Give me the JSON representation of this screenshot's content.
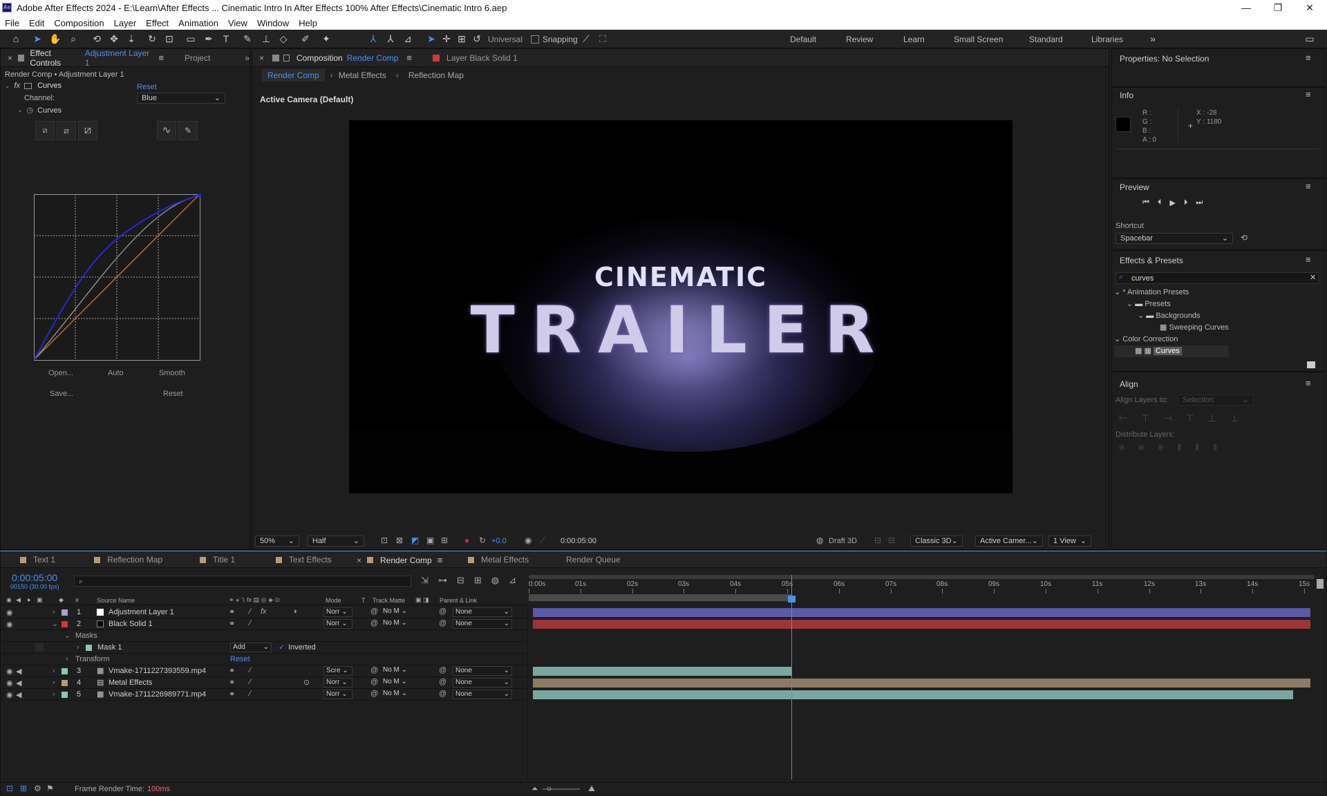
{
  "app": {
    "title": "Adobe After Effects 2024 - E:\\Learn\\After Effects ... Cinematic Intro In After Effects 100% After Effects\\Cinematic Intro 6.aep",
    "logo": "Ae"
  },
  "menu": [
    "File",
    "Edit",
    "Composition",
    "Layer",
    "Effect",
    "Animation",
    "View",
    "Window",
    "Help"
  ],
  "toolbar": {
    "universal": "Universal",
    "snapping": "Snapping",
    "workspaces": [
      "Default",
      "Review",
      "Learn",
      "Small Screen",
      "Standard",
      "Libraries"
    ]
  },
  "effect_controls": {
    "tab_label": "Effect Controls",
    "tab_layer": "Adjustment Layer 1",
    "project_tab": "Project",
    "breadcrumb": "Render Comp • Adjustment Layer 1",
    "effect_name": "Curves",
    "reset": "Reset",
    "channel_label": "Channel:",
    "channel_value": "Blue",
    "curves_label": "Curves",
    "buttons": [
      "Open...",
      "Auto",
      "Smooth",
      "Save...",
      "Reset"
    ]
  },
  "comp_panel": {
    "tab_label": "Composition",
    "tab_comp": "Render Comp",
    "layer_tab": "Layer  Black Solid 1",
    "nav": [
      "Render Comp",
      "Metal Effects",
      "Reflection Map"
    ],
    "camera": "Active Camera (Default)",
    "viewer_title_top": "CINEMATIC",
    "viewer_title_main": "TRAILER",
    "zoom": "50%",
    "resolution": "Half",
    "exposure": "+0.0",
    "timecode": "0:00:05:00",
    "renderer_label": "Draft 3D",
    "renderer": "Classic 3D",
    "camera_select": "Active Camer...",
    "views": "1 View"
  },
  "properties": {
    "title": "Properties: No Selection"
  },
  "info": {
    "title": "Info",
    "r": "R :",
    "g": "G :",
    "b": "B :",
    "a": "A : 0",
    "x": "X : -28",
    "y": "Y : 1180"
  },
  "preview": {
    "title": "Preview",
    "shortcut_label": "Shortcut",
    "shortcut": "Spacebar"
  },
  "effects_presets": {
    "title": "Effects & Presets",
    "search": "curves",
    "tree": [
      {
        "label": "* Animation Presets",
        "indent": 0
      },
      {
        "label": "Presets",
        "indent": 1
      },
      {
        "label": "Backgrounds",
        "indent": 2
      },
      {
        "label": "Sweeping Curves",
        "indent": 3
      },
      {
        "label": "Color Correction",
        "indent": 0
      },
      {
        "label": "Curves",
        "indent": 1
      }
    ]
  },
  "align": {
    "title": "Align",
    "align_to_label": "Align Layers to:",
    "align_to": "Selection",
    "distribute": "Distribute Layers:"
  },
  "timeline": {
    "tabs": [
      "Text 1",
      "Reflection Map",
      "Title 1",
      "Text Effects",
      "Render Comp",
      "Metal Effects",
      "Render Queue"
    ],
    "timecode": "0:00:05:00",
    "frames": "00150 (30.00 fps)",
    "columns": {
      "num": "#",
      "source": "Source Name",
      "mode": "Mode",
      "t": "T",
      "track": "Track Matte",
      "parent": "Parent & Link"
    },
    "ruler": [
      "0:00s",
      "01s",
      "02s",
      "03s",
      "04s",
      "05s",
      "06s",
      "07s",
      "08s",
      "09s",
      "10s",
      "11s",
      "12s",
      "13s",
      "14s",
      "15s"
    ],
    "layers": [
      {
        "num": "1",
        "name": "Adjustment Layer 1",
        "color": "#a9a2cc",
        "mode": "Norr",
        "track": "No M",
        "parent": "None"
      },
      {
        "num": "2",
        "name": "Black Solid 1",
        "color": "#cc3a3a",
        "mode": "Norr",
        "track": "No M",
        "parent": "None"
      },
      {
        "num": "3",
        "name": "Vmake-1711227393559.mp4",
        "color": "#8fc6b8",
        "mode": "Scre",
        "track": "No M",
        "parent": "None"
      },
      {
        "num": "4",
        "name": "Metal Effects",
        "color": "#b89a78",
        "mode": "Norr",
        "track": "No M",
        "parent": "None"
      },
      {
        "num": "5",
        "name": "Vmake-1711226989771.mp4",
        "color": "#8fc6b8",
        "mode": "Norr",
        "track": "No M",
        "parent": "None"
      }
    ],
    "masks_label": "Masks",
    "mask1": "Mask 1",
    "mask_mode": "Add",
    "inverted": "Inverted",
    "transform": "Transform",
    "reset": "Reset",
    "frame_render_label": "Frame Render Time:",
    "frame_render_value": "100ms"
  },
  "colors": {
    "accent": "#4d8ff0",
    "layer1_bar": "#5a5aa8",
    "layer2_bar": "#9c3636",
    "layer3_bar": "#7aa8a0",
    "layer4_bar": "#8c7a64",
    "layer5_bar": "#7aa8a0"
  }
}
